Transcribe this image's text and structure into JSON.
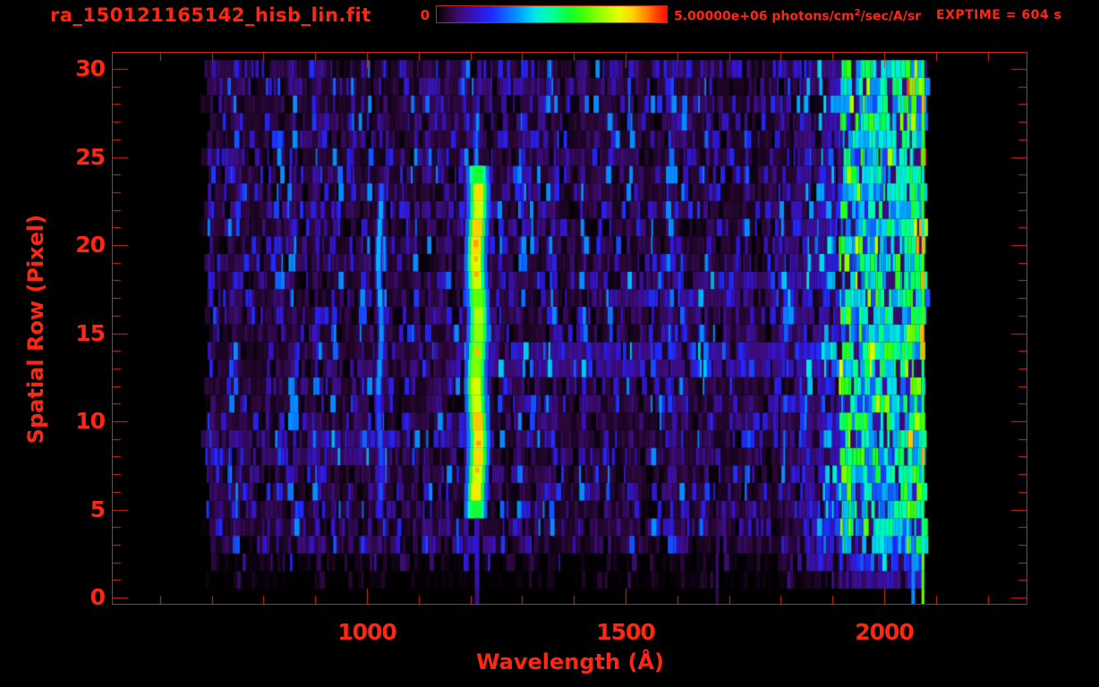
{
  "window": {
    "background": "#000000"
  },
  "colors": {
    "text_red": "#ff2713",
    "axis_red": "#e02d15",
    "box_red": "#c8280f"
  },
  "header": {
    "title": "ra_150121165142_hisb_lin.fit",
    "exptime_label": "EXPTIME = 604 s",
    "colorbar": {
      "min_label": "0",
      "min_value": 0,
      "max_value": 5000000,
      "max_label_prefix": "5.00000e+06 photons/cm",
      "max_label_sup": "2",
      "max_label_suffix": "/sec/A/sr"
    }
  },
  "chart_data": {
    "type": "heatmap",
    "title": "ra_150121165142_hisb_lin.fit",
    "xlabel": "Wavelength (Å)",
    "ylabel": "Spatial Row (Pixel)",
    "x_ticks_major": [
      1000,
      1500,
      2000
    ],
    "x_tick_minor_step_angstrom": 100,
    "x_minor_tick_range": [
      600,
      2200
    ],
    "x_range": [
      507,
      2277
    ],
    "y_ticks_major": [
      0,
      5,
      10,
      15,
      20,
      25,
      30
    ],
    "y_tick_minor_step": 1,
    "y_range": [
      -0.4,
      31.0
    ],
    "grid": false,
    "legend": "colorbar-top",
    "colorbar": {
      "min": 0,
      "max": 5000000,
      "units": "photons/cm^2/sec/A/sr"
    },
    "exptime_seconds": 604,
    "colormap_stops": [
      [
        0.0,
        "#000000"
      ],
      [
        0.05,
        "#2a0736"
      ],
      [
        0.1,
        "#3c0d7a"
      ],
      [
        0.17,
        "#3414c8"
      ],
      [
        0.24,
        "#1f2bff"
      ],
      [
        0.3,
        "#0f64ff"
      ],
      [
        0.37,
        "#00aaff"
      ],
      [
        0.43,
        "#00e8e8"
      ],
      [
        0.5,
        "#00ffa0"
      ],
      [
        0.57,
        "#0bff3c"
      ],
      [
        0.64,
        "#46ff00"
      ],
      [
        0.72,
        "#9cff00"
      ],
      [
        0.79,
        "#e6ff00"
      ],
      [
        0.85,
        "#ffd300"
      ],
      [
        0.91,
        "#ff8800"
      ],
      [
        0.96,
        "#ff3c00"
      ],
      [
        1.0,
        "#ff0f00"
      ]
    ],
    "features": [
      {
        "name": "geocoronal-lyman-alpha-emission-line",
        "wavelength": 1213,
        "row_span": [
          5,
          24
        ],
        "relative_intensity": 0.85
      },
      {
        "name": "lyman-beta-emission-line",
        "wavelength": 1025,
        "row_span": [
          5,
          23
        ],
        "relative_intensity": 0.3
      },
      {
        "name": "long-wavelength-airglow-band",
        "wavelength_span": [
          1795,
          2082
        ],
        "row_span": [
          2,
          30
        ],
        "relative_intensity": 0.45
      },
      {
        "name": "faint-column-below-lyman-alpha",
        "wavelength": 1213,
        "row_span": [
          0,
          4
        ],
        "relative_intensity": 0.15
      },
      {
        "name": "faint-purple-column",
        "wavelength": 1676,
        "row_span": [
          0,
          5
        ],
        "relative_intensity": 0.08
      },
      {
        "name": "background-noise-band",
        "wavelength_span": [
          674,
          2082
        ],
        "row_span": [
          1,
          30
        ],
        "relative_intensity": 0.08
      }
    ],
    "render": {
      "seed": 1337,
      "data_x_span": [
        674,
        2082
      ],
      "noise": {
        "cell_min": 2,
        "cell_max": 7,
        "blue_fraction": 0.25,
        "gap_fraction": 0.16,
        "column_streaks": 110
      },
      "right_band": {
        "start": 1795,
        "bright_start": 1912,
        "end": 2082
      },
      "lines": {
        "lyman_alpha": {
          "wavelength": 1213,
          "rows": [
            5,
            24
          ],
          "width": 26
        },
        "lyman_beta": {
          "wavelength": 1025,
          "rows": [
            5,
            23
          ],
          "width": 9
        },
        "lya_foot": {
          "wavelength": 1213,
          "rows": [
            0,
            4
          ],
          "width": 5
        },
        "faint_column": {
          "wavelength": 1676,
          "rows": [
            0,
            5
          ],
          "width": 3
        },
        "green_column": {
          "wavelength": 2074,
          "rows": [
            0,
            30
          ],
          "width": 3
        },
        "blue_column": {
          "wavelength": 2056,
          "rows": [
            0,
            3
          ],
          "width": 4
        }
      }
    }
  }
}
